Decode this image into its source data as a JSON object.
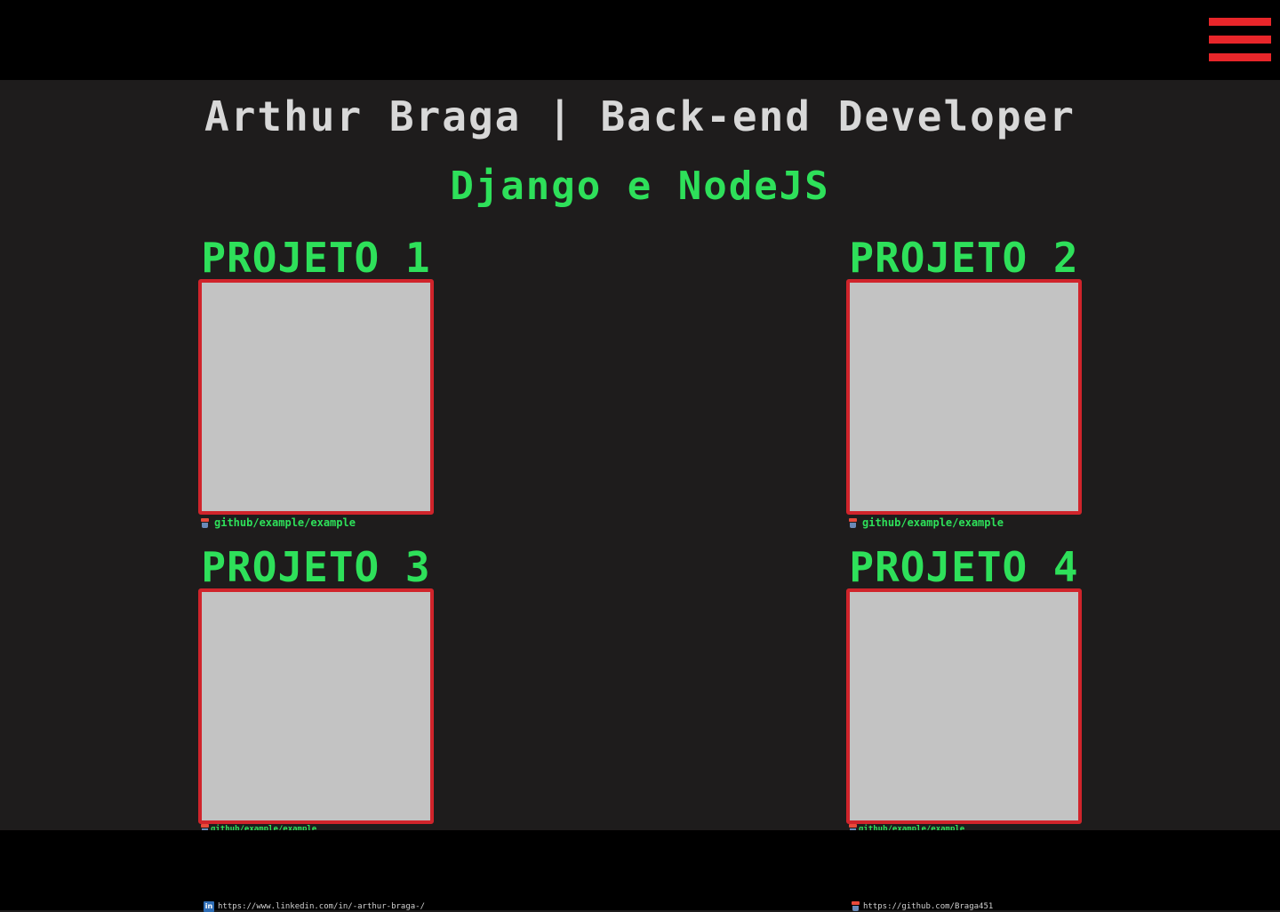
{
  "header": {
    "menu_icon": "hamburger-icon",
    "accent": "#e8262a"
  },
  "hero": {
    "title": "Arthur Braga | Back-end Developer",
    "subtitle": "Django e NodeJS"
  },
  "projects": [
    {
      "title": "PROJETO 1",
      "link": "github/example/example"
    },
    {
      "title": "PROJETO 2",
      "link": "github/example/example"
    },
    {
      "title": "PROJETO 3",
      "link": "github/example/example"
    },
    {
      "title": "PROJETO 4",
      "link": "github/example/example"
    }
  ],
  "footer": {
    "linkedin": "https://www.linkedin.com/in/-arthur-braga-/",
    "github": "https://github.com/Braga451"
  },
  "colors": {
    "background": "#1e1c1c",
    "bars": "#000000",
    "green": "#2ee05a",
    "frame_border": "#d0242b",
    "frame_fill": "#c3c3c3"
  }
}
